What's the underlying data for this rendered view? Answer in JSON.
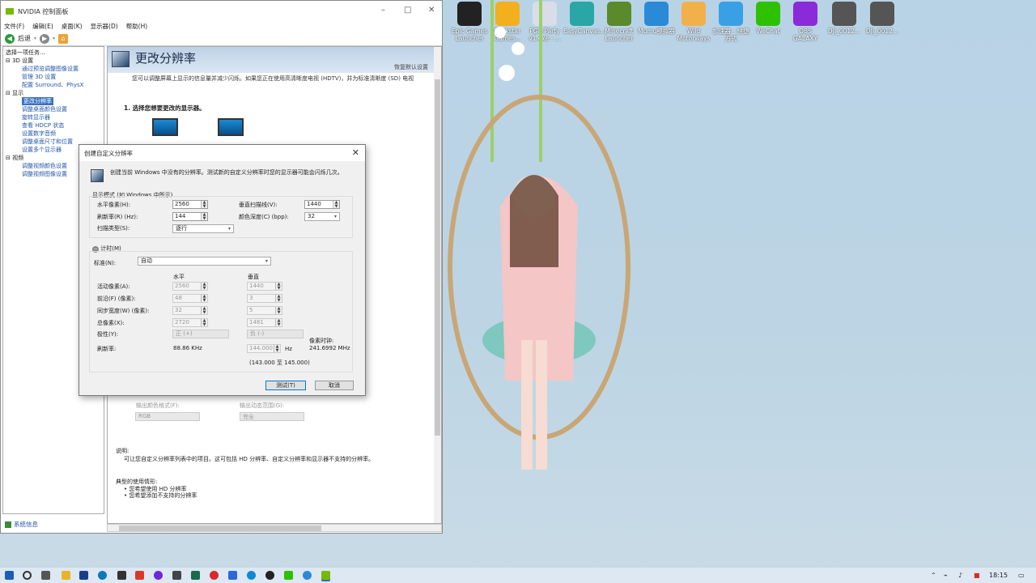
{
  "window": {
    "title": "NVIDIA 控制面板",
    "menu": [
      "文件(F)",
      "编辑(E)",
      "桌面(K)",
      "显示器(D)",
      "帮助(H)"
    ],
    "back_label": "后退"
  },
  "left_pane": {
    "header": "选择一项任务...",
    "tree": [
      {
        "label": "3D 设置",
        "type": "cat"
      },
      {
        "label": "通过预览调整图像设置",
        "type": "sub"
      },
      {
        "label": "管理 3D 设置",
        "type": "sub"
      },
      {
        "label": "配置 Surround、PhysX",
        "type": "sub"
      },
      {
        "label": "显示",
        "type": "cat"
      },
      {
        "label": "更改分辨率",
        "type": "sel"
      },
      {
        "label": "调整桌面颜色设置",
        "type": "sub"
      },
      {
        "label": "旋转显示器",
        "type": "sub"
      },
      {
        "label": "查看 HDCP 状态",
        "type": "sub"
      },
      {
        "label": "设置数字音频",
        "type": "sub"
      },
      {
        "label": "调整桌面尺寸和位置",
        "type": "sub"
      },
      {
        "label": "设置多个显示器",
        "type": "sub"
      },
      {
        "label": "视频",
        "type": "cat"
      },
      {
        "label": "调整视频颜色设置",
        "type": "sub"
      },
      {
        "label": "调整视频图像设置",
        "type": "sub"
      }
    ],
    "system_info": "系统信息"
  },
  "right_pane": {
    "title": "更改分辨率",
    "restore": "恢复默认设置",
    "description": "您可以调整屏幕上显示的信息量并减少闪烁。如果您正在使用高清晰度电视 (HDTV)，并为标准清晰度 (SD) 电视",
    "step1": "1. 选择您想要更改的显示器。",
    "output_color_format_label": "输出颜色格式(F):",
    "output_color_format_value": "RGB",
    "output_dynamic_range_label": "输出动态范围(G):",
    "output_dynamic_range_value": "完全",
    "explain_title": "说明:",
    "explain_text": "可让您自定义分辨率列表中的项目。这可包括 HD 分辨率、自定义分辨率和显示器不支持的分辨率。",
    "usage_title": "典型的使用情形:",
    "usage_items": [
      "• 您希望使用 HD 分辨率",
      "• 您希望添加不支持的分辨率"
    ]
  },
  "dialog": {
    "title": "创建自定义分辨率",
    "intro": "创建当前 Windows 中没有的分辨率。测试新的自定义分辨率时您的显示器可能会闪烁几次。",
    "display_mode_label": "显示模式 (如 Windows 中所示)",
    "h_pixels_label": "水平像素(H):",
    "h_pixels_value": "2560",
    "v_lines_label": "垂直扫描线(V):",
    "v_lines_value": "1440",
    "refresh_label": "刷新率(R) (Hz):",
    "refresh_value": "144",
    "color_depth_label": "颜色深度(C) (bpp):",
    "color_depth_value": "32",
    "scan_type_label": "扫描类型(S):",
    "scan_type_value": "逐行",
    "timing_label": "计时(M)",
    "standard_label": "标准(N):",
    "standard_value": "自动",
    "col_h": "水平",
    "col_v": "垂直",
    "rows": [
      {
        "label": "活动像素(A):",
        "h": "2560",
        "v": "1440"
      },
      {
        "label": "前沿(F) (像素):",
        "h": "48",
        "v": "3"
      },
      {
        "label": "同步宽度(W) (像素):",
        "h": "32",
        "v": "5"
      },
      {
        "label": "总像素(X):",
        "h": "2720",
        "v": "1481"
      }
    ],
    "polarity_label": "极性(Y):",
    "polarity_h": "正 (+)",
    "polarity_v": "负 (-)",
    "pixel_clock_label": "像素时钟:",
    "pixel_clock_value": "241.6992 MHz",
    "refresh_row_label": "刷新率:",
    "refresh_h": "88.86 KHz",
    "refresh_v": "144.000",
    "refresh_unit": "Hz",
    "refresh_range": "(143.000 至 145.000)",
    "test_button": "测试(T)",
    "cancel_button": "取消"
  },
  "desktop_icons": [
    {
      "label": "Epic Games Launcher",
      "icon": "epic-icon",
      "color": "#222222"
    },
    {
      "label": "Rockstar Games...",
      "icon": "rockstar-icon",
      "color": "#f2b01e"
    },
    {
      "label": "PGR Party v1.exe - ...",
      "icon": "pgr-icon",
      "color": "#d8dde8"
    },
    {
      "label": "EasyCanvas...",
      "icon": "easycanvas-icon",
      "color": "#2aa6a6"
    },
    {
      "label": "Minecraft Launcher",
      "icon": "minecraft-icon",
      "color": "#5a8a2c"
    },
    {
      "label": "Mumu模拟器",
      "icon": "mumu-icon",
      "color": "#2a8ad8"
    },
    {
      "label": "Wild Motorways",
      "icon": "wild-icon",
      "color": "#f2b04a"
    },
    {
      "label": "加速器 - 快捷方式",
      "icon": "booster-icon",
      "color": "#3aa0e6"
    },
    {
      "label": "WeChat",
      "icon": "wechat-icon",
      "color": "#2dc100"
    },
    {
      "label": "OBS GALAXY",
      "icon": "obs-icon",
      "color": "#8a2ad8"
    },
    {
      "label": "DJI_0012...",
      "icon": "video-file-icon",
      "color": "#555555"
    },
    {
      "label": "DJI_0012...",
      "icon": "video-file-icon",
      "color": "#555555"
    }
  ],
  "taskbar": {
    "time": "18:15",
    "lang": "中"
  }
}
